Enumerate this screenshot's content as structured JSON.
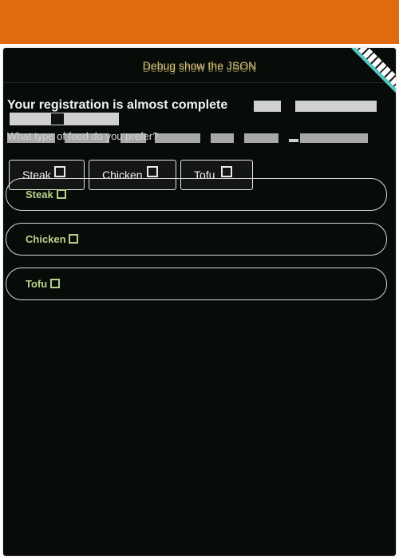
{
  "debug_label": "Debug show the JSON",
  "title": "Your registration is almost complete",
  "question": "What type of food do you prefer?",
  "food_chips": [
    {
      "label": "Steak"
    },
    {
      "label": "Chicken"
    },
    {
      "label": "Tofu"
    }
  ],
  "food_options": [
    {
      "label": "Steak",
      "checked": false
    },
    {
      "label": "Chicken",
      "checked": false
    },
    {
      "label": "Tofu",
      "checked": false
    }
  ],
  "colors": {
    "header_bar": "#df6a10",
    "panel_background": "#080c08",
    "option_text": "#b8d18c",
    "debug_text": "#d6c27a",
    "ribbon_accent": "#54c8c4"
  },
  "icons": [
    "checkbox-icon",
    "corner-ribbon"
  ]
}
